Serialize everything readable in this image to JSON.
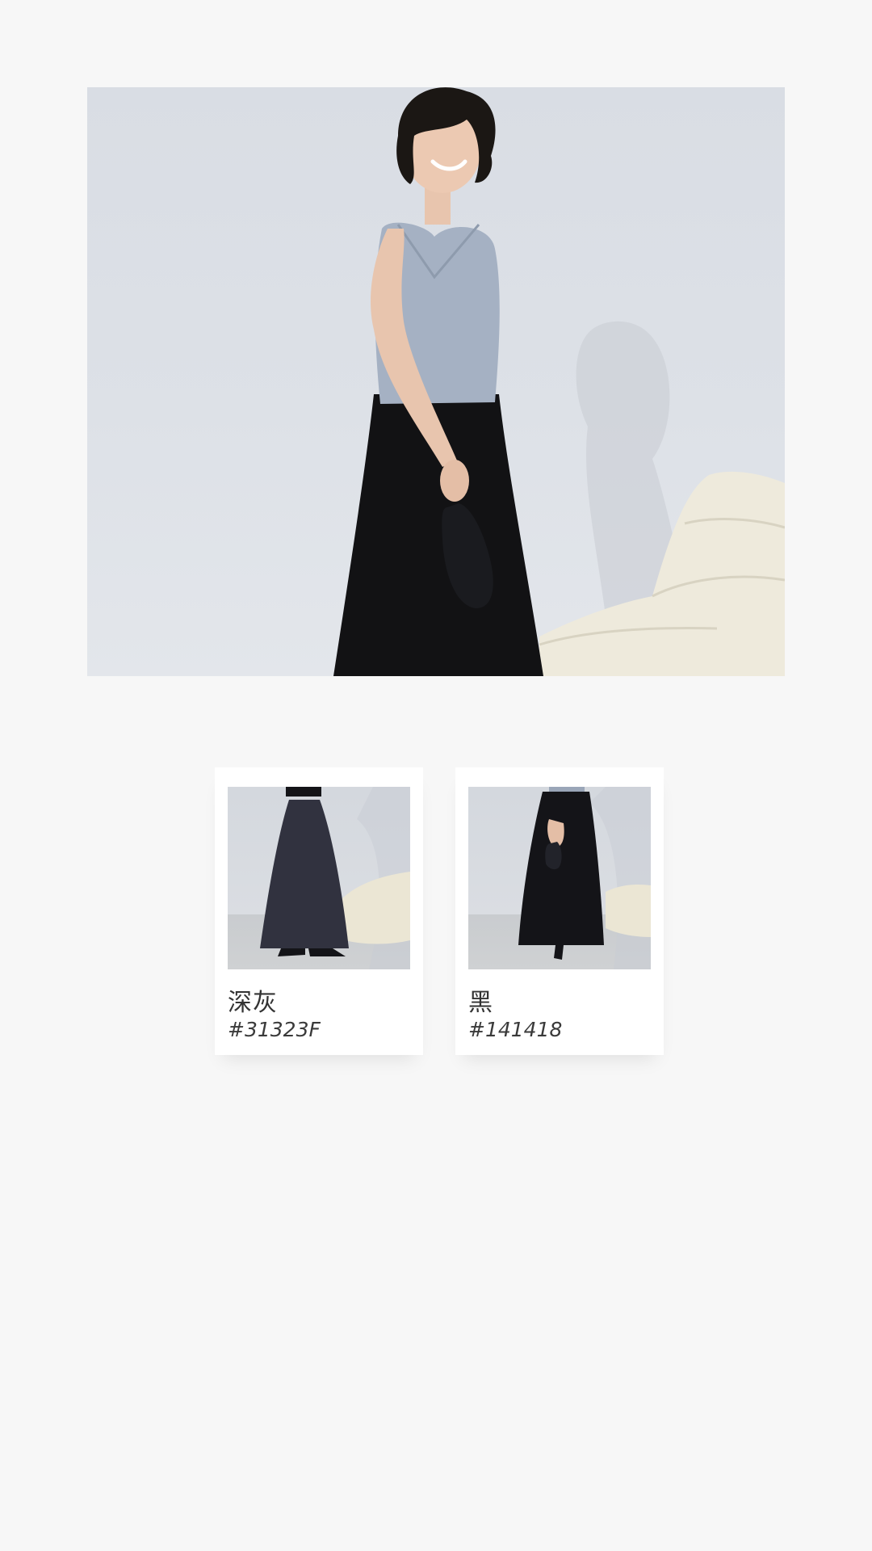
{
  "hero": {
    "image": "model-in-camisole-and-maxi-skirt"
  },
  "swatches": [
    {
      "name": "深灰",
      "hex": "#31323F",
      "skirt_color": "#31323F"
    },
    {
      "name": "黑",
      "hex": "#141418",
      "skirt_color": "#141418"
    }
  ]
}
